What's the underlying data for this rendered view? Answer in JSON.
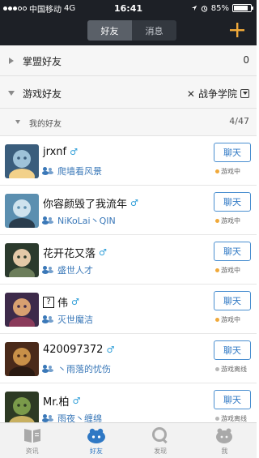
{
  "status_bar": {
    "carrier": "中国移动",
    "network": "4G",
    "time": "16:41",
    "battery": "85%",
    "battery_fill": 0.85
  },
  "nav": {
    "tabs": [
      {
        "label": "好友",
        "active": true
      },
      {
        "label": "消息",
        "active": false
      }
    ],
    "add_icon": "plus-icon"
  },
  "groups": {
    "alliance": {
      "label": "掌盟好友",
      "count": "0"
    },
    "game": {
      "label": "游戏好友",
      "filter_label": "战争学院"
    },
    "my_friends": {
      "label": "我的好友",
      "count": "4/47"
    }
  },
  "friends": [
    {
      "name": "jrxnf",
      "gender": "♂",
      "game_name": "爬墙看风景",
      "chat_label": "聊天",
      "status": "游戏中",
      "status_color": "#f0a93a",
      "avatar_colors": [
        "#3a5d7c",
        "#9ec2d8",
        "#f2d18a"
      ]
    },
    {
      "name": "你容颜毁了我流年",
      "gender": "♂",
      "game_name": "NiKoLai丶QIN",
      "chat_label": "聊天",
      "status": "游戏中",
      "status_color": "#f0a93a",
      "avatar_colors": [
        "#5b8fb0",
        "#cfe3ee",
        "#2a3d4d"
      ]
    },
    {
      "name": "花开花又落",
      "gender": "♂",
      "game_name": "盛世人才",
      "chat_label": "聊天",
      "status": "游戏中",
      "status_color": "#f0a93a",
      "avatar_colors": [
        "#2b3a2d",
        "#e4c9a8",
        "#6c7d5a"
      ]
    },
    {
      "name": "伟",
      "name_prefix": "?",
      "gender": "♂",
      "game_name": "灭世魔洁",
      "chat_label": "聊天",
      "status": "游戏中",
      "status_color": "#f0a93a",
      "avatar_colors": [
        "#3d2a4a",
        "#d8a070",
        "#8a3a5a"
      ]
    },
    {
      "name": "420097372",
      "gender": "♂",
      "game_name": "丶雨落的忧伤",
      "chat_label": "聊天",
      "status": "游戏离线",
      "status_color": "#b8b8b8",
      "avatar_colors": [
        "#4a2a1a",
        "#c89048",
        "#2a1a12"
      ]
    },
    {
      "name": "Mr.柏",
      "gender": "♂",
      "game_name": "雨夜丶缠绵",
      "chat_label": "聊天",
      "status": "游戏离线",
      "status_color": "#b8b8b8",
      "avatar_colors": [
        "#2d3a24",
        "#7a9a4a",
        "#c8b060"
      ]
    }
  ],
  "tabbar": [
    {
      "label": "资讯",
      "icon": "news-book-icon",
      "active": false
    },
    {
      "label": "好友",
      "icon": "friends-icon",
      "active": true
    },
    {
      "label": "发现",
      "icon": "discover-search-icon",
      "active": false
    },
    {
      "label": "我",
      "icon": "profile-icon",
      "active": false
    }
  ]
}
